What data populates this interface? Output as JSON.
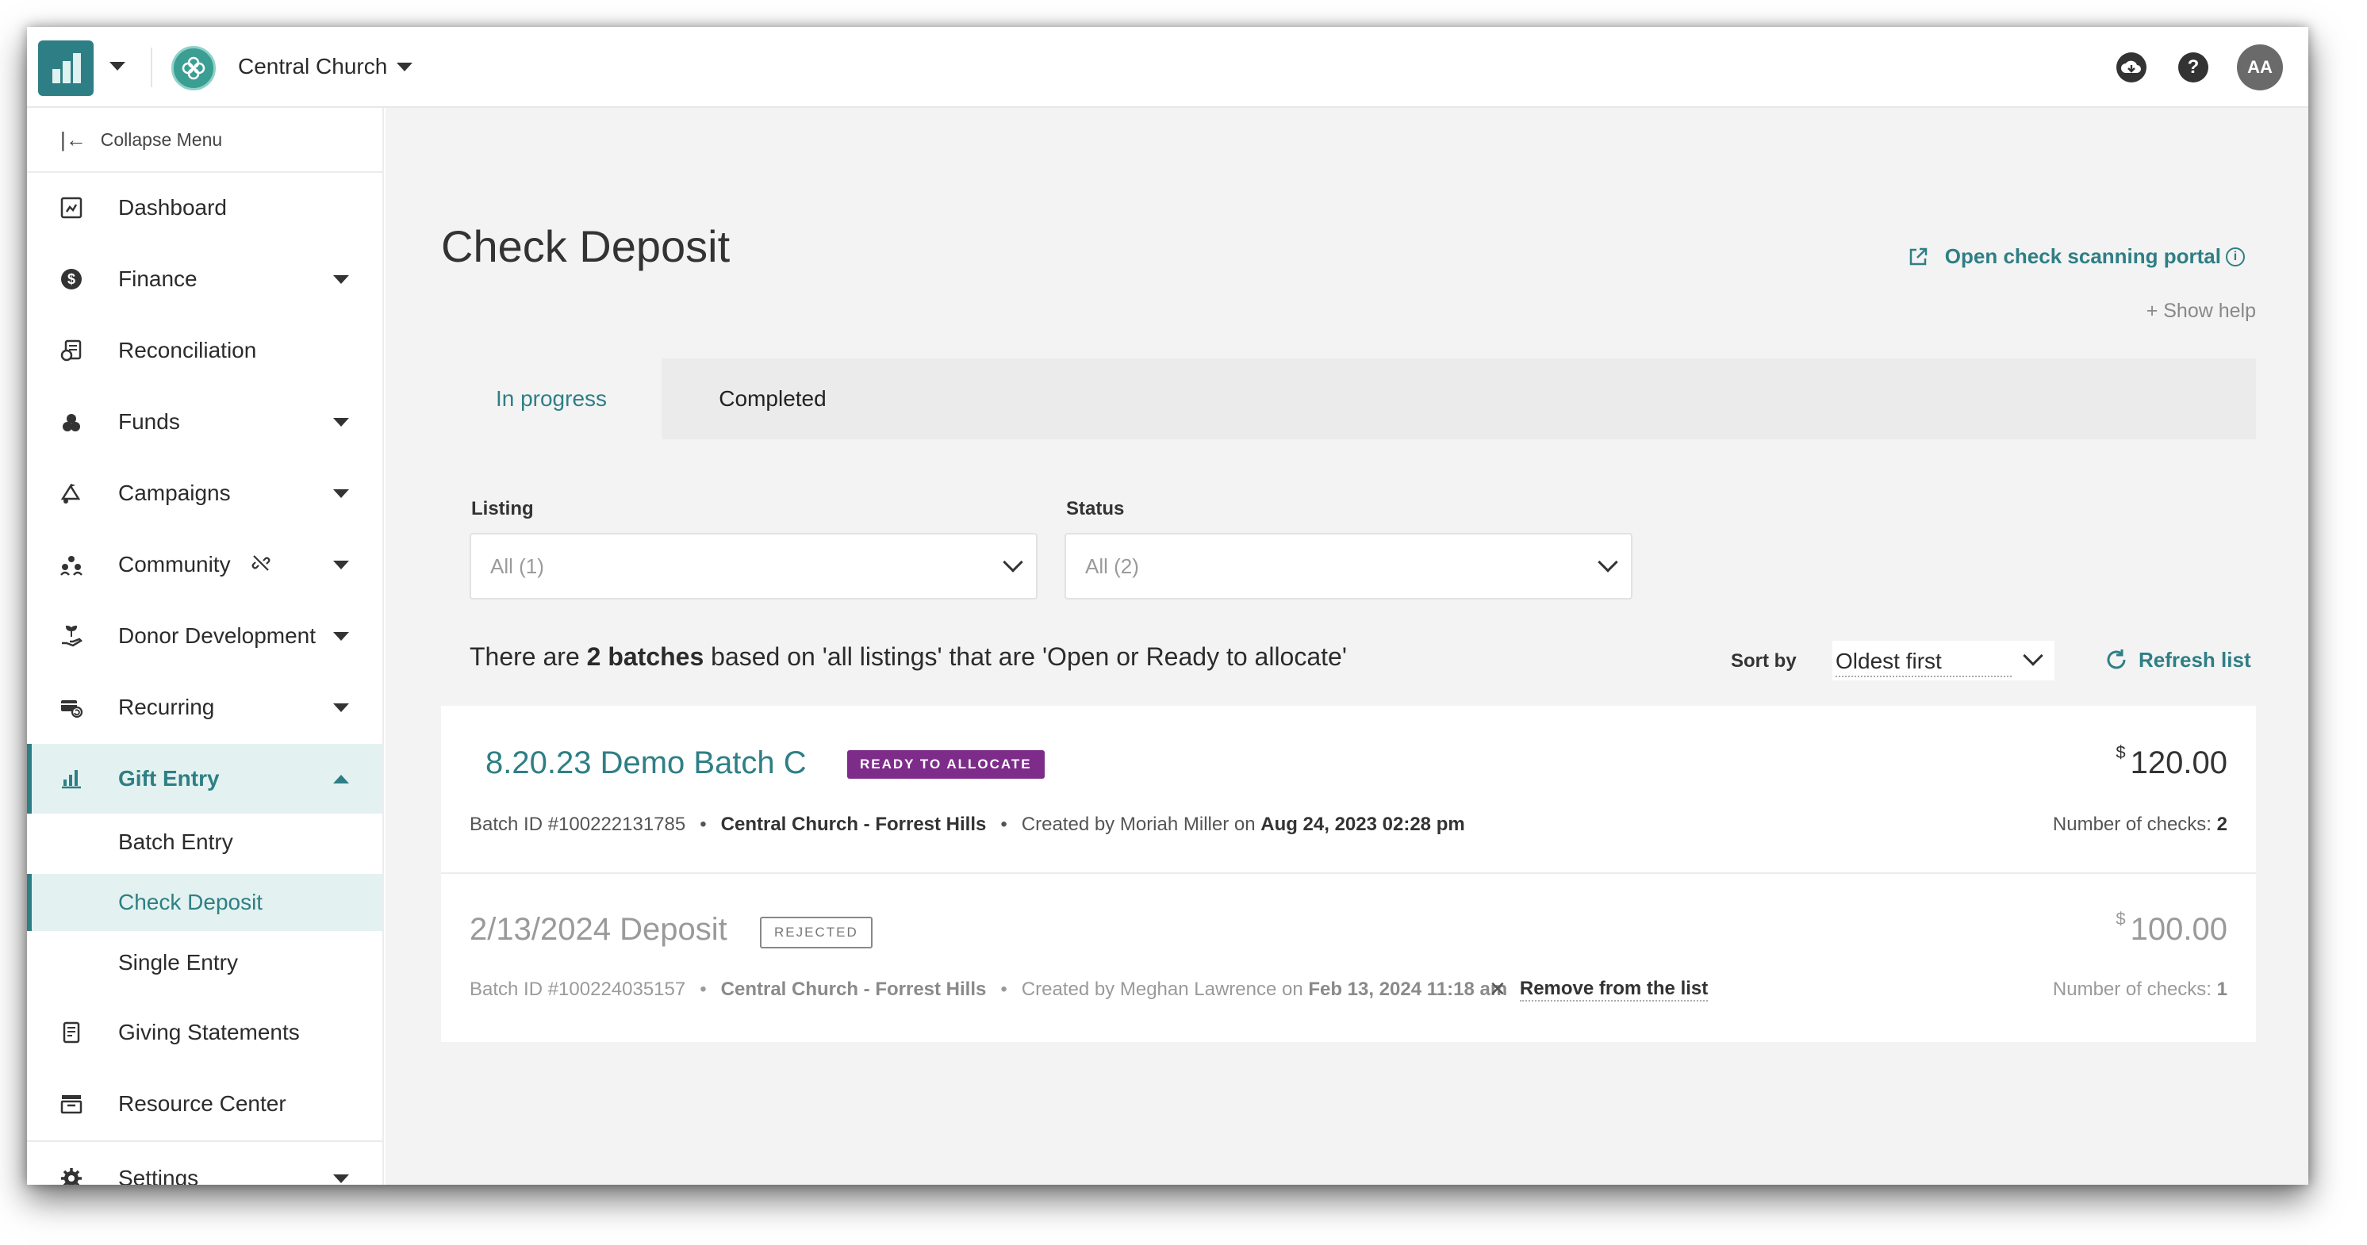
{
  "topbar": {
    "org_name": "Central Church",
    "avatar_initials": "AA",
    "help_icon": "?"
  },
  "sidebar": {
    "collapse_label": "Collapse Menu",
    "items": [
      {
        "label": "Dashboard",
        "icon": "dashboard-icon"
      },
      {
        "label": "Finance",
        "icon": "dollar-icon"
      },
      {
        "label": "Reconciliation",
        "icon": "reconciliation-icon"
      },
      {
        "label": "Funds",
        "icon": "funds-icon"
      },
      {
        "label": "Campaigns",
        "icon": "campaigns-icon"
      },
      {
        "label": "Community",
        "icon": "community-icon"
      },
      {
        "label": "Donor Development",
        "icon": "donor-development-icon"
      },
      {
        "label": "Recurring",
        "icon": "recurring-icon"
      },
      {
        "label": "Gift Entry",
        "icon": "gift-entry-icon"
      },
      {
        "label": "Giving Statements",
        "icon": "giving-statements-icon"
      },
      {
        "label": "Resource Center",
        "icon": "resource-center-icon"
      },
      {
        "label": "Settings",
        "icon": "gear-icon"
      }
    ],
    "gift_entry_sub": [
      {
        "label": "Batch Entry"
      },
      {
        "label": "Check Deposit"
      },
      {
        "label": "Single Entry"
      }
    ]
  },
  "main": {
    "title": "Check Deposit",
    "portal_link": "Open check scanning portal",
    "show_help": "+ Show help",
    "tabs": [
      {
        "label": "In progress",
        "active": true
      },
      {
        "label": "Completed",
        "active": false
      }
    ],
    "filters": {
      "listing_label": "Listing",
      "listing_value": "All (1)",
      "status_label": "Status",
      "status_value": "All (2)"
    },
    "summary": {
      "prefix": "There are ",
      "count": "2 batches",
      "suffix": " based on 'all listings' that are 'Open or Ready to allocate'"
    },
    "sort": {
      "label": "Sort by",
      "value": "Oldest first"
    },
    "refresh_label": "Refresh list",
    "batches": [
      {
        "name": "8.20.23 Demo Batch C",
        "status": "READY TO ALLOCATE",
        "batch_id": "Batch ID #100222131785",
        "location": "Central Church - Forrest Hills",
        "created_prefix": "Created by Moriah Miller on ",
        "created_date": "Aug 24, 2023 02:28 pm",
        "currency": "$",
        "amount": "120.00",
        "checks_label": "Number of checks: ",
        "checks_count": "2"
      },
      {
        "name": "2/13/2024 Deposit",
        "status": "REJECTED",
        "batch_id": "Batch ID #100224035157",
        "location": "Central Church - Forrest Hills",
        "created_prefix": "Created by Meghan Lawrence on ",
        "created_date": "Feb 13, 2024 11:18 am",
        "remove_label": "Remove from the list",
        "currency": "$",
        "amount": "100.00",
        "checks_label": "Number of checks: ",
        "checks_count": "1"
      }
    ]
  },
  "colors": {
    "accent": "#2e7f85",
    "ready_badge": "#7e2c8a",
    "active_bg": "#e3f2f0"
  }
}
